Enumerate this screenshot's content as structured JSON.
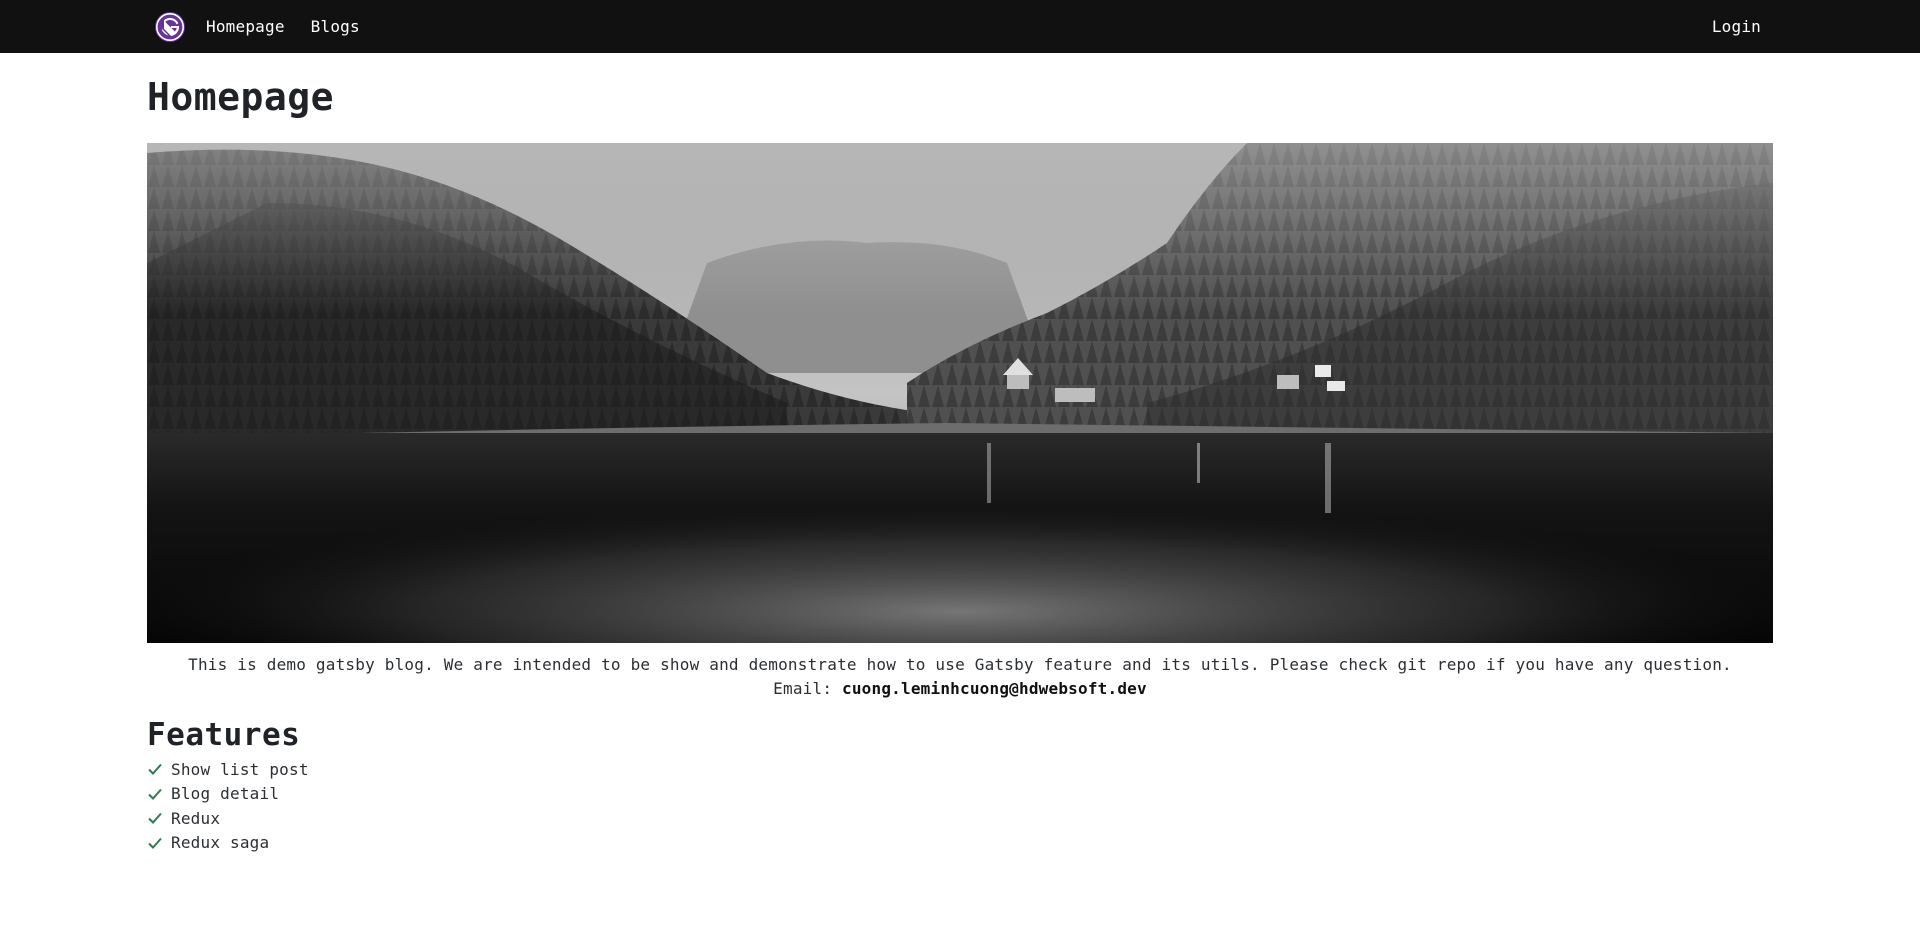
{
  "nav": {
    "logo_icon": "gatsby-logo-icon",
    "links": [
      "Homepage",
      "Blogs"
    ],
    "login_label": "Login"
  },
  "main": {
    "title": "Homepage",
    "hero_image": "foggy-lake-forest-landscape",
    "description": "This is demo gatsby blog. We are intended to be show and demonstrate how to use Gatsby feature and its utils. Please check git repo if you have any question.",
    "email_label": "Email:",
    "email_value": "cuong.leminhcuong@hdwebsoft.dev"
  },
  "features": {
    "title": "Features",
    "items": [
      "Show list post",
      "Blog detail",
      "Redux",
      "Redux saga"
    ],
    "check_icon": "check-icon",
    "check_color": "#2e7d52"
  },
  "colors": {
    "nav_bg": "#111111",
    "logo_purple": "#663399"
  }
}
